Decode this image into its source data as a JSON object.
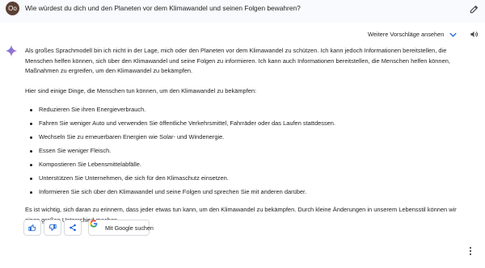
{
  "user": {
    "avatar_initials": "Oo",
    "avatar_color": "#5b4034"
  },
  "prompt": "Wie würdest du dich und den Planeten vor dem Klimawandel und seinen Folgen bewahren?",
  "header": {
    "drafts_label": "Weitere Vorschläge ansehen"
  },
  "response": {
    "intro": "Als großes Sprachmodell bin ich nicht in der Lage, mich oder den Planeten vor dem Klimawandel zu schützen. Ich kann jedoch Informationen bereitstellen, die Menschen helfen können, sich über den Klimawandel und seine Folgen zu informieren. Ich kann auch Informationen bereitstellen, die Menschen helfen können, Maßnahmen zu ergreifen, um den Klimawandel zu bekämpfen.",
    "list_intro": "Hier sind einige Dinge, die Menschen tun können, um den Klimawandel zu bekämpfen:",
    "items": [
      "Reduzieren Sie ihren Energieverbrauch.",
      "Fahren Sie weniger Auto und verwenden Sie öffentliche Verkehrsmittel, Fahrräder oder das Laufen stattdessen.",
      "Wechseln Sie zu erneuerbaren Energien wie Solar- und Windenergie.",
      "Essen Sie weniger Fleisch.",
      "Kompostieren Sie Lebensmittelabfälle.",
      "Unterstützen Sie Unternehmen, die sich für den Klimaschutz einsetzen.",
      "Informieren Sie sich über den Klimawandel und seine Folgen und sprechen Sie mit anderen darüber."
    ],
    "closing": "Es ist wichtig, sich daran zu erinnern, dass jeder etwas tun kann, um den Klimawandel zu bekämpfen. Durch kleine Änderungen in unserem Lebensstil können wir einen großen Unterschied machen."
  },
  "actions": {
    "google_label": "Mit Google suchen"
  },
  "icons": [
    "edit-icon",
    "sparkle-icon",
    "chevron-down-icon",
    "speaker-icon",
    "thumbs-up-icon",
    "thumbs-down-icon",
    "share-icon",
    "google-icon",
    "more-vert-icon"
  ],
  "colors": {
    "accent": "#1a73e8",
    "background": "#f8fafd"
  }
}
